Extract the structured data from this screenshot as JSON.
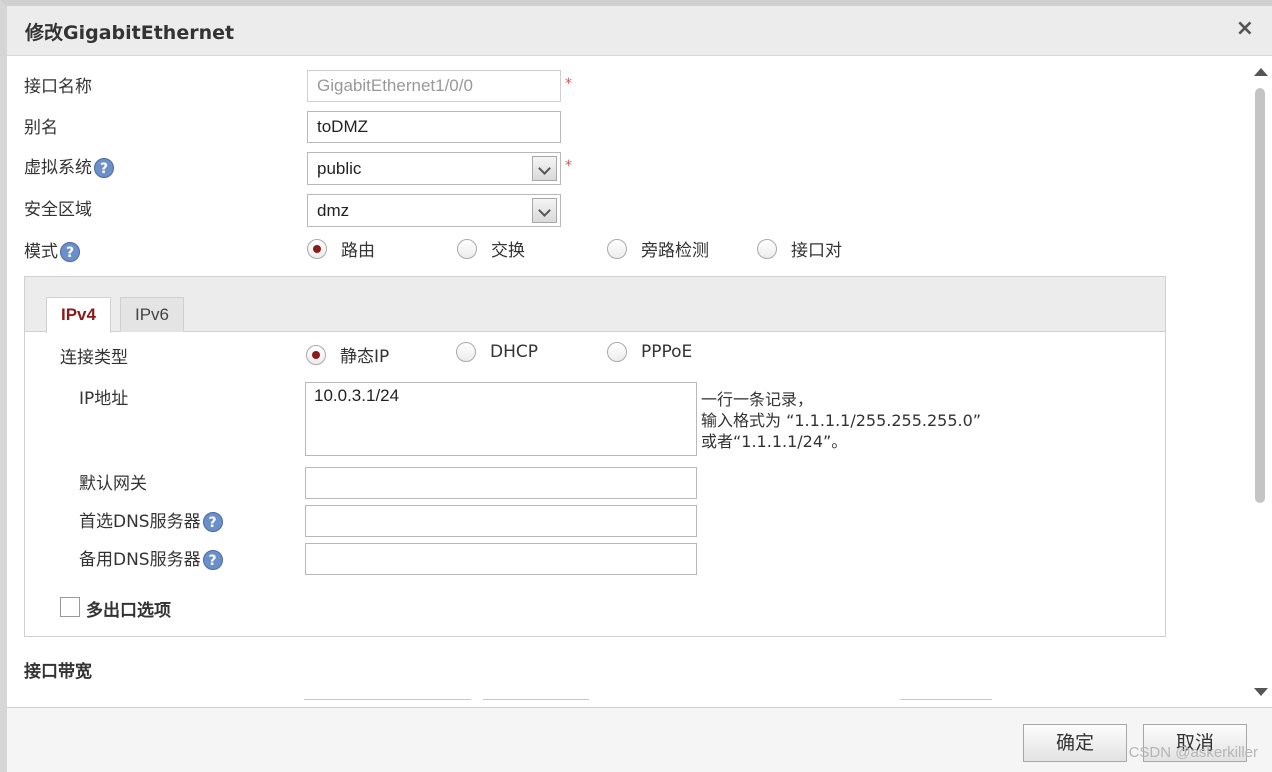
{
  "dialog": {
    "title": "修改GigabitEthernet",
    "close_icon": "×"
  },
  "form": {
    "interface_name_label": "接口名称",
    "interface_name_value": "GigabitEthernet1/0/0",
    "alias_label": "别名",
    "alias_value": "toDMZ",
    "vsys_label": "虚拟系统",
    "vsys_value": "public",
    "zone_label": "安全区域",
    "zone_value": "dmz",
    "mode_label": "模式",
    "mode_options": [
      "路由",
      "交换",
      "旁路检测",
      "接口对"
    ],
    "mode_selected": "路由",
    "required_mark": "*",
    "help_mark": "?"
  },
  "tabs": [
    {
      "label": "IPv4",
      "active": true
    },
    {
      "label": "IPv6",
      "active": false
    }
  ],
  "ipv4": {
    "conn_type_label": "连接类型",
    "conn_options": [
      "静态IP",
      "DHCP",
      "PPPoE"
    ],
    "conn_selected": "静态IP",
    "ip_label": "IP地址",
    "ip_value": "10.0.3.1/24",
    "ip_hint_line1": "一行一条记录，",
    "ip_hint_line2": "输入格式为 “1.1.1.1/255.255.255.0”",
    "ip_hint_line3": "或者“1.1.1.1/24”。",
    "gateway_label": "默认网关",
    "gateway_value": "",
    "dns1_label": "首选DNS服务器",
    "dns1_value": "",
    "dns2_label": "备用DNS服务器",
    "dns2_value": "",
    "multi_exit_label": "多出口选项",
    "multi_exit_checked": false
  },
  "bandwidth": {
    "section_label": "接口带宽"
  },
  "footer": {
    "ok_label": "确定",
    "cancel_label": "取消"
  },
  "watermark": "CSDN @askerkiller",
  "colors": {
    "accent": "#8b1a1a",
    "required": "#d9534f",
    "help": "#6b8fc9"
  }
}
